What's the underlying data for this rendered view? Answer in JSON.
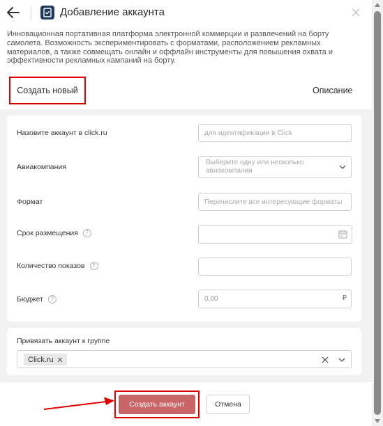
{
  "header": {
    "title": "Добавление аккаунта",
    "back_icon": "arrow-left-icon",
    "app_icon": "clipboard-icon",
    "close_icon": "close-icon"
  },
  "description": "Инновационная портативная платформа электронной коммерции и развлечений на борту самолета. Возможность экспериментировать с форматами, расположением рекламных материалов, а также совмещать онлайн и оффлайн инструменты для повышения охвата и эффективности рекламных кампаний на борту.",
  "tabs": {
    "create_new": "Создать новый",
    "description": "Описание"
  },
  "form": {
    "account_name": {
      "label": "Назовите аккаунт в click.ru",
      "placeholder": "для идентификации в Click"
    },
    "airline": {
      "label": "Авиакомпания",
      "placeholder": "Выберите одну или несколько авиакомпании"
    },
    "format": {
      "label": "Формат",
      "placeholder": "Перечислите все интересующие форматы"
    },
    "period": {
      "label": "Срок размещения",
      "help": "?"
    },
    "impressions": {
      "label": "Количество показов",
      "help": "?"
    },
    "budget": {
      "label": "Бюджет",
      "help": "?",
      "value": "0,00",
      "currency": "₽"
    }
  },
  "group": {
    "label": "Привязать аккаунт к группе",
    "selected": "Click.ru"
  },
  "footer": {
    "create_button": "Создать аккаунт",
    "cancel_button": "Отмена"
  },
  "colors": {
    "primary_button": "#c96467",
    "highlight": "#e00000",
    "background_gray": "#f2f2f3"
  }
}
